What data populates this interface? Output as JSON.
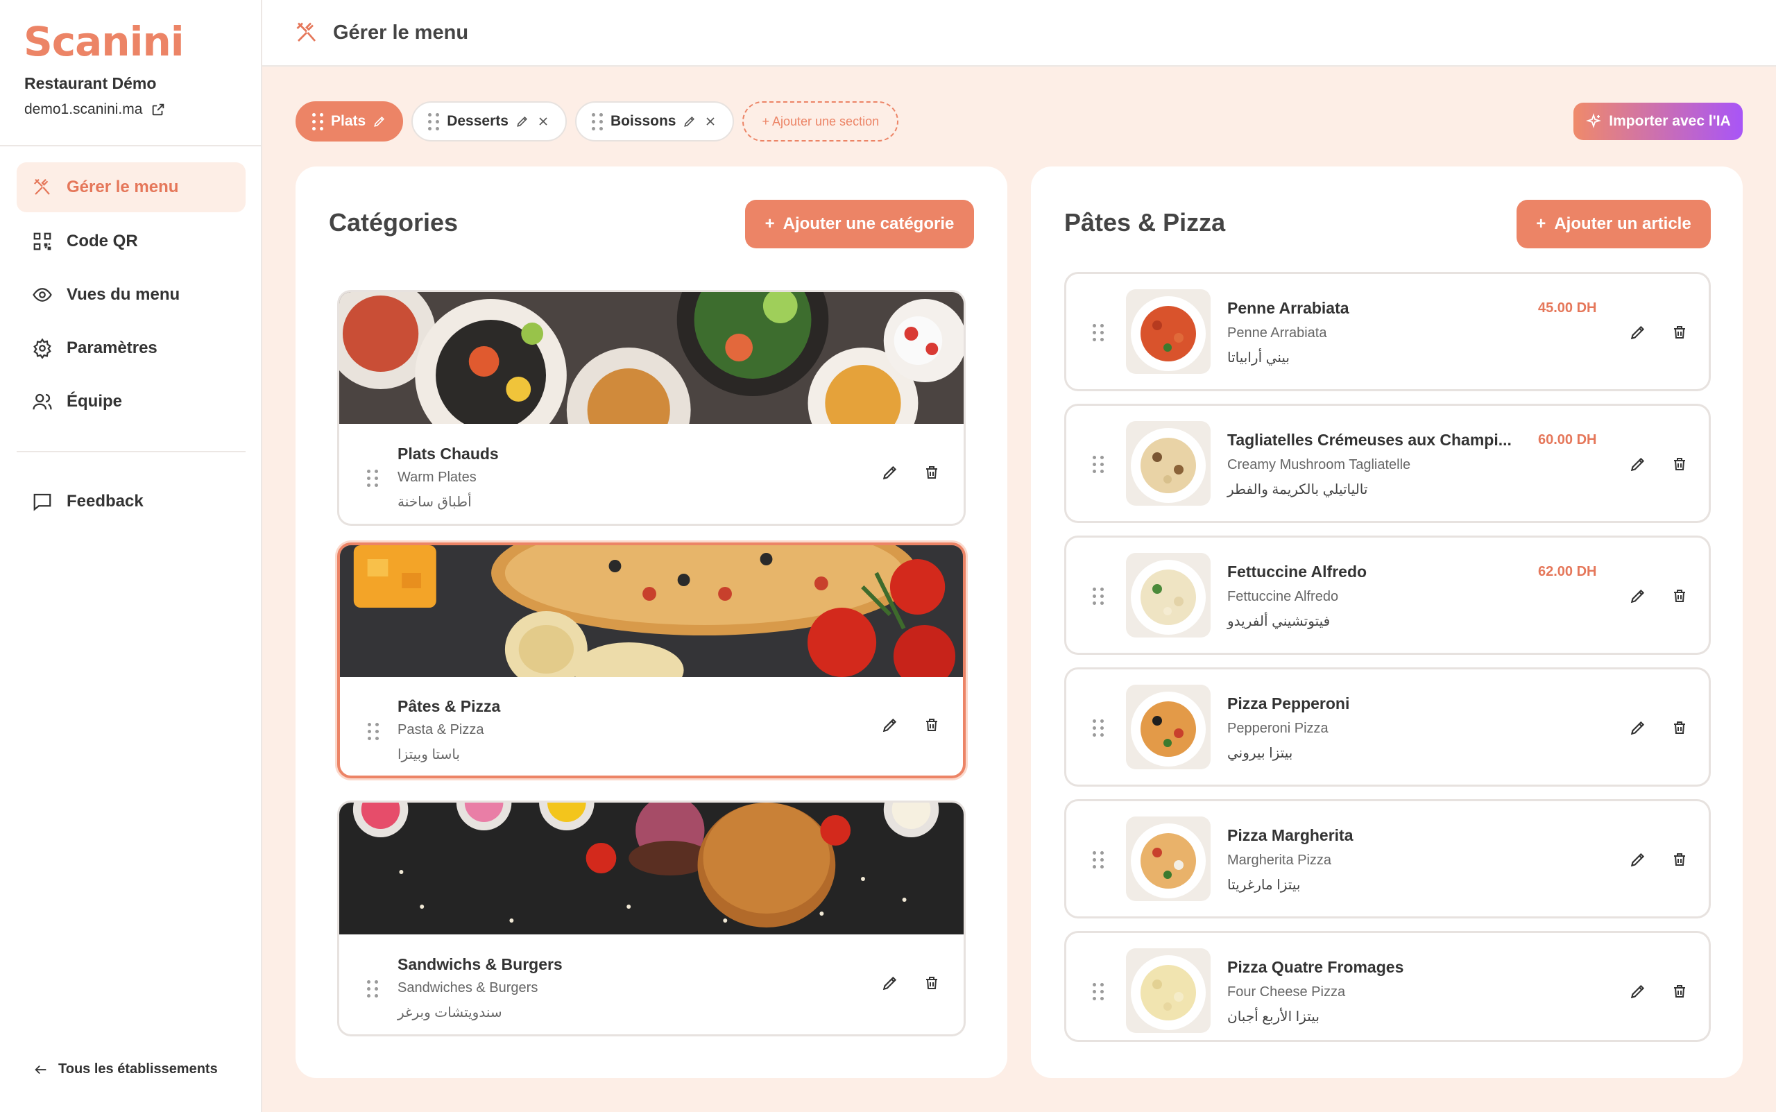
{
  "app": {
    "logo": "Scanini",
    "restaurant_name": "Restaurant Démo",
    "restaurant_url": "demo1.scanini.ma"
  },
  "sidebar": {
    "items": [
      {
        "label": "Gérer le menu",
        "icon": "utensils-icon",
        "active": true
      },
      {
        "label": "Code QR",
        "icon": "qr-code-icon"
      },
      {
        "label": "Vues du menu",
        "icon": "eye-icon"
      },
      {
        "label": "Paramètres",
        "icon": "gear-icon"
      },
      {
        "label": "Équipe",
        "icon": "users-icon"
      }
    ],
    "feedback": "Feedback",
    "back": "Tous les établissements"
  },
  "header": {
    "title": "Gérer le menu"
  },
  "sections": {
    "tabs": [
      {
        "label": "Plats",
        "active": true
      },
      {
        "label": "Desserts"
      },
      {
        "label": "Boissons"
      }
    ],
    "add_label": "+ Ajouter une section",
    "ai_button": "Importer avec l'IA"
  },
  "categories": {
    "title": "Catégories",
    "add_button": "Ajouter une catégorie",
    "list": [
      {
        "name": "Plats Chauds",
        "en": "Warm Plates",
        "ar": "أطباق ساخنة"
      },
      {
        "name": "Pâtes & Pizza",
        "en": "Pasta & Pizza",
        "ar": "باستا وبيتزا",
        "selected": true
      },
      {
        "name": "Sandwichs & Burgers",
        "en": "Sandwiches & Burgers",
        "ar": "سندويتشات وبرغر"
      }
    ]
  },
  "items": {
    "title": "Pâtes & Pizza",
    "add_button": "Ajouter un article",
    "list": [
      {
        "name": "Penne Arrabiata",
        "en": "Penne Arrabiata",
        "ar": "بيني أرابياتا",
        "price": "45.00 DH"
      },
      {
        "name": "Tagliatelles Crémeuses aux Champi...",
        "en": "Creamy Mushroom Tagliatelle",
        "ar": "تالياتيلي بالكريمة والفطر",
        "price": "60.00 DH"
      },
      {
        "name": "Fettuccine Alfredo",
        "en": "Fettuccine Alfredo",
        "ar": "فيتوتشيني ألفريدو",
        "price": "62.00 DH"
      },
      {
        "name": "Pizza Pepperoni",
        "en": "Pepperoni Pizza",
        "ar": "بيتزا بيروني",
        "price": ""
      },
      {
        "name": "Pizza Margherita",
        "en": "Margherita Pizza",
        "ar": "بيتزا مارغريتا",
        "price": ""
      },
      {
        "name": "Pizza Quatre Fromages",
        "en": "Four Cheese Pizza",
        "ar": "بيتزا الأربع أجبان",
        "price": ""
      }
    ]
  },
  "colors": {
    "accent": "#ec8466",
    "background": "#fdeee6",
    "ai_gradient_end": "#a855f7"
  }
}
